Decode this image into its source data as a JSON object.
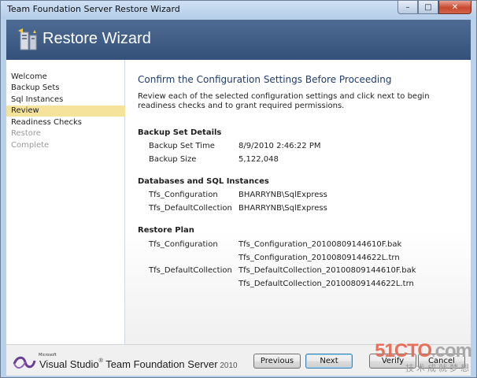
{
  "window": {
    "title": "Team Foundation Server Restore Wizard"
  },
  "caption": {
    "minimize": "–",
    "maximize": "□",
    "close": "✕"
  },
  "banner": {
    "title": "Restore Wizard"
  },
  "nav": [
    {
      "label": "Welcome",
      "state": "normal"
    },
    {
      "label": "Backup Sets",
      "state": "normal"
    },
    {
      "label": "Sql Instances",
      "state": "normal"
    },
    {
      "label": "Review",
      "state": "active"
    },
    {
      "label": "Readiness Checks",
      "state": "normal"
    },
    {
      "label": "Restore",
      "state": "disabled"
    },
    {
      "label": "Complete",
      "state": "disabled"
    }
  ],
  "content": {
    "heading": "Confirm the Configuration Settings Before Proceeding",
    "description": "Review each of the selected configuration settings and click next to begin readiness checks and to grant required permissions.",
    "backup": {
      "title": "Backup Set Details",
      "time_label": "Backup Set Time",
      "time_value": "8/9/2010 2:46:22 PM",
      "size_label": "Backup Size",
      "size_value": "5,122,048"
    },
    "databases": {
      "title": "Databases and SQL Instances",
      "rows": [
        {
          "name": "Tfs_Configuration",
          "value": "BHARRYNB\\SqlExpress"
        },
        {
          "name": "Tfs_DefaultCollection",
          "value": "BHARRYNB\\SqlExpress"
        }
      ]
    },
    "plan": {
      "title": "Restore Plan",
      "rows": [
        {
          "name": "Tfs_Configuration",
          "file1": "Tfs_Configuration_20100809144610F.bak",
          "file2": "Tfs_Configuration_20100809144622L.trn"
        },
        {
          "name": "Tfs_DefaultCollection",
          "file1": "Tfs_DefaultCollection_20100809144610F.bak",
          "file2": "Tfs_DefaultCollection_20100809144622L.trn"
        }
      ]
    }
  },
  "footer": {
    "brand_microsoft": "Microsoft",
    "brand_product": "Visual Studio",
    "brand_reg": "®",
    "brand_suffix": " Team Foundation Server",
    "brand_year": " 2010",
    "previous_label": "Previous",
    "next_label": "Next",
    "verify_label": "Verify",
    "cancel_label": "Cancel"
  },
  "watermark": {
    "site": "51CTO",
    "dot": ".",
    "tld": "com",
    "slogan": "技术成就梦想"
  },
  "colors": {
    "banner": "#3e5d86",
    "active_nav": "#f6e39b",
    "heading": "#1f3d6d",
    "watermark": "#e6705c"
  }
}
